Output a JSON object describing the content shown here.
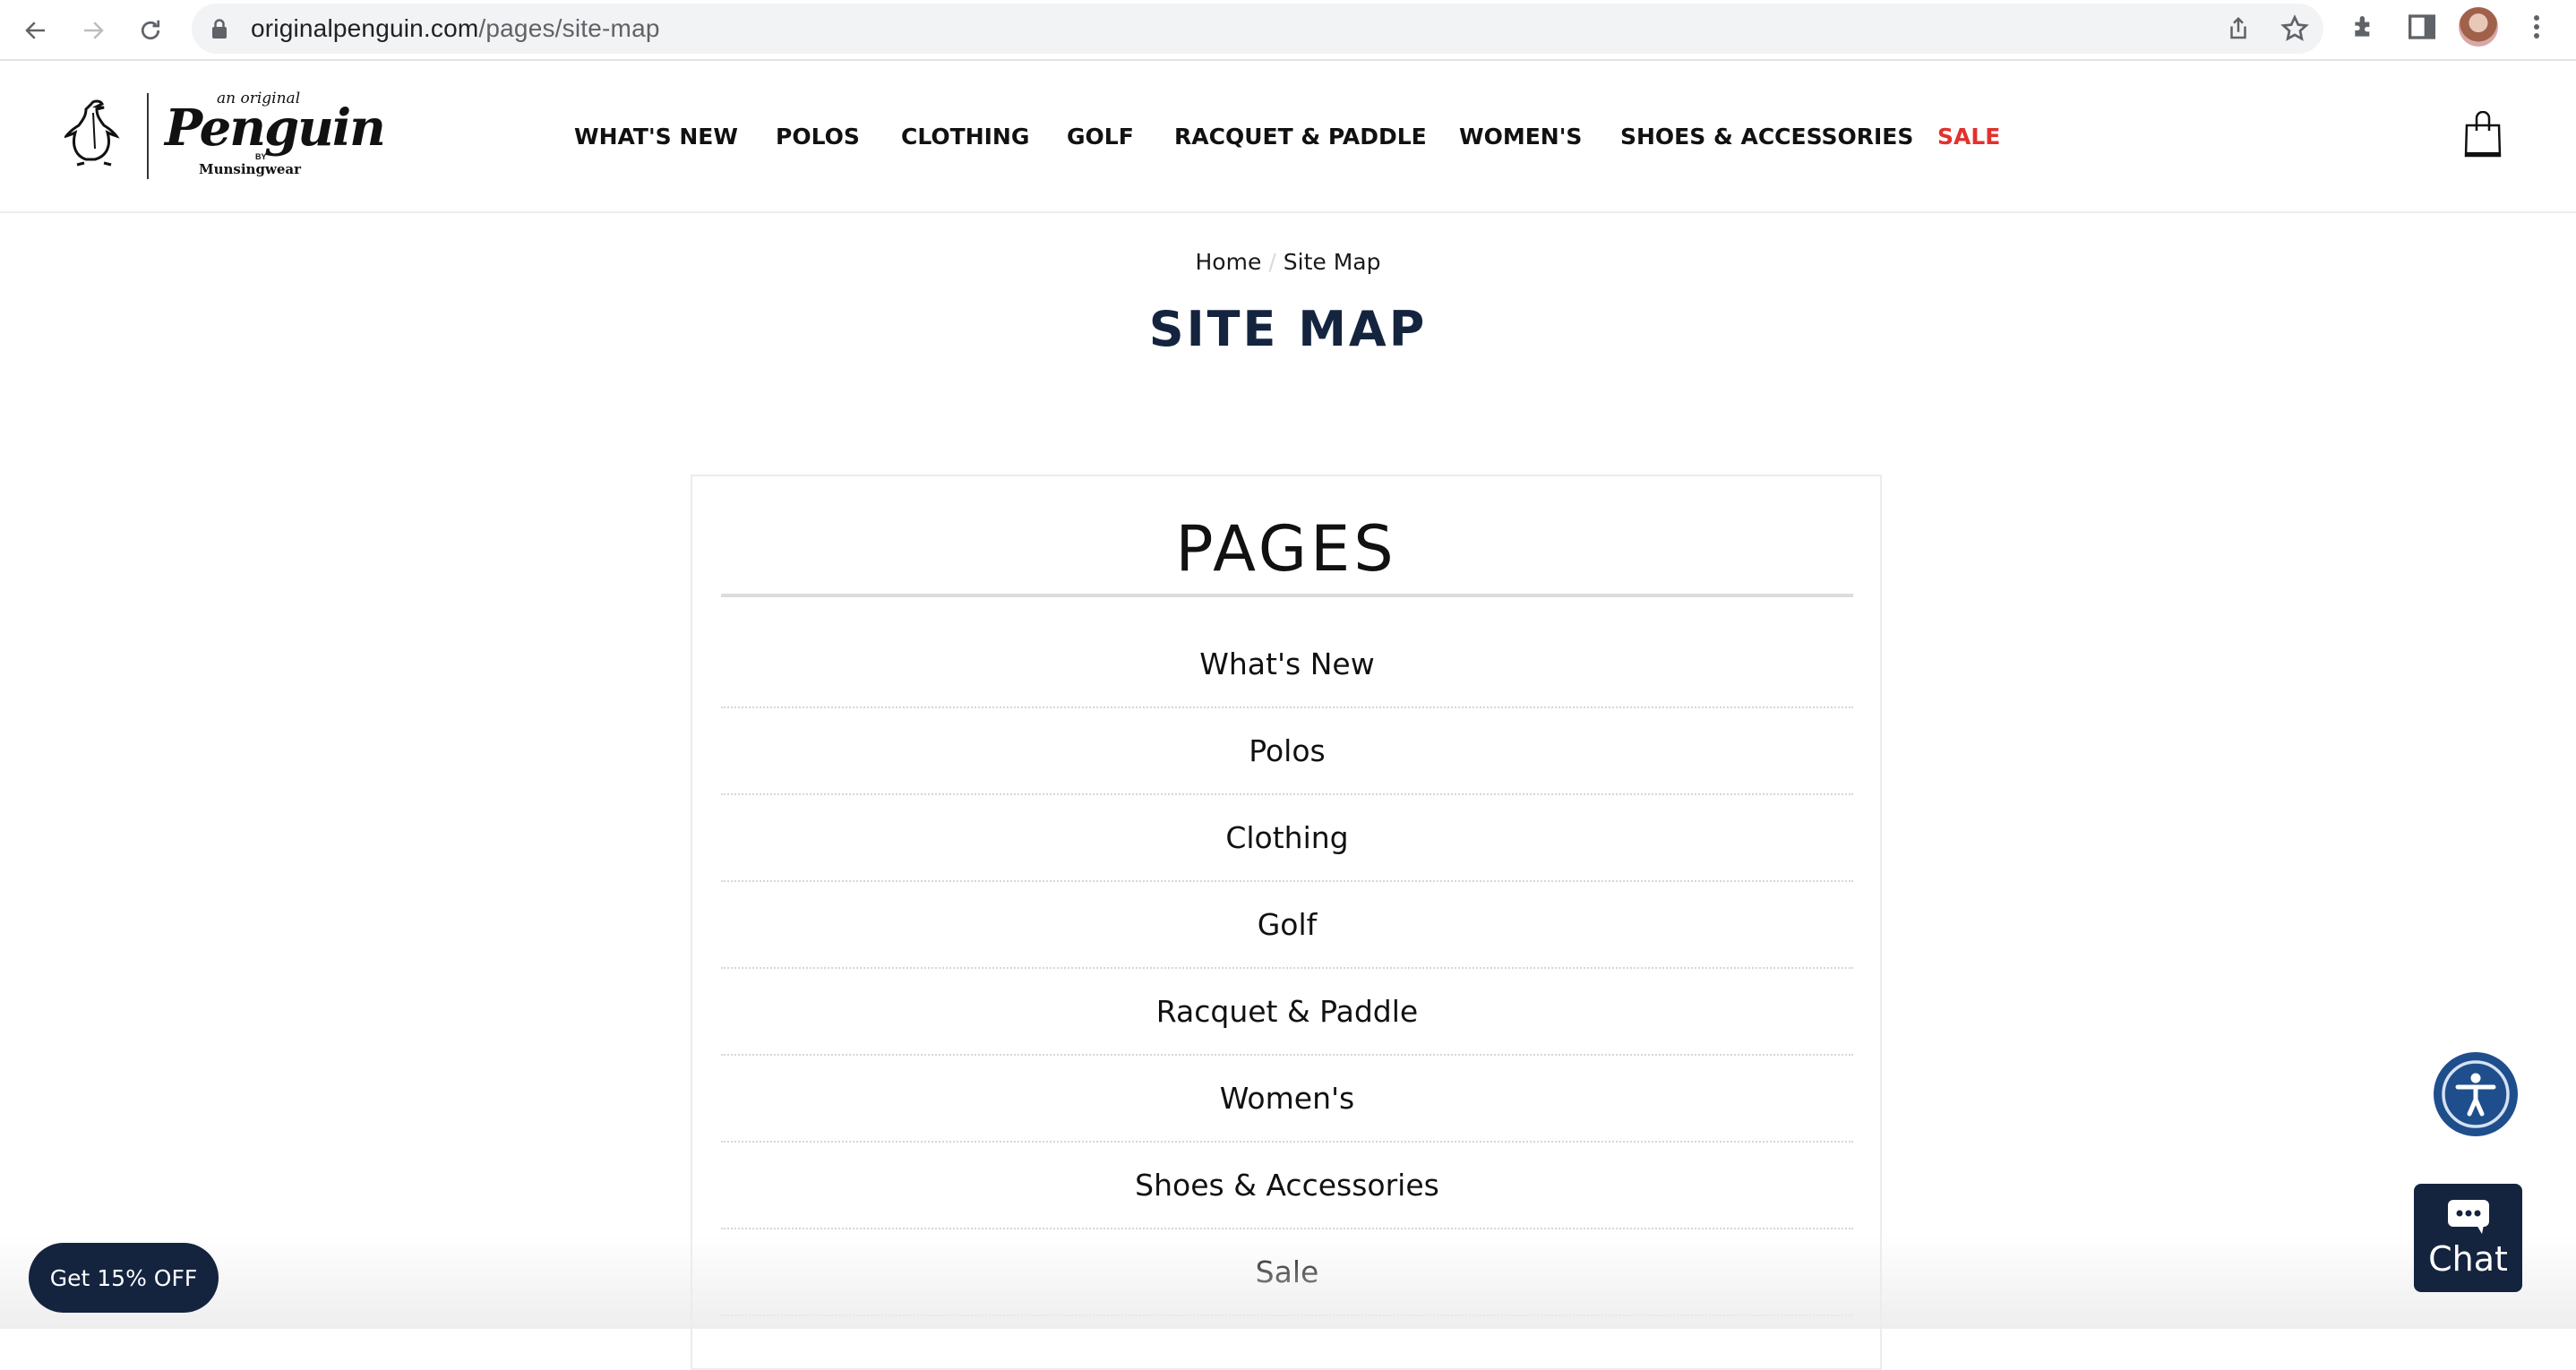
{
  "browser": {
    "url_domain": "originalpenguin.com",
    "url_path": "/pages/site-map"
  },
  "header": {
    "logo": {
      "tagline": "an original",
      "brand": "Penguin",
      "by": "BY",
      "maker": "Munsingwear"
    },
    "nav": [
      {
        "label": "WHAT'S NEW"
      },
      {
        "label": "POLOS"
      },
      {
        "label": "CLOTHING"
      },
      {
        "label": "GOLF"
      },
      {
        "label": "RACQUET & PADDLE"
      },
      {
        "label": "WOMEN'S"
      },
      {
        "label": "SHOES & ACCESSORIES"
      },
      {
        "label": "SALE"
      }
    ],
    "sale_color": "#e2312d"
  },
  "breadcrumb": {
    "home": "Home",
    "separator": "/",
    "current": "Site Map"
  },
  "page": {
    "title": "SITE MAP",
    "title_color": "#14243f"
  },
  "pages_section": {
    "heading": "PAGES",
    "items": [
      {
        "label": "What's New"
      },
      {
        "label": "Polos"
      },
      {
        "label": "Clothing"
      },
      {
        "label": "Golf"
      },
      {
        "label": "Racquet & Paddle"
      },
      {
        "label": "Women's"
      },
      {
        "label": "Shoes & Accessories"
      },
      {
        "label": "Sale"
      }
    ]
  },
  "widgets": {
    "promo_label": "Get 15% OFF",
    "chat_label": "Chat",
    "accent": "#14243f",
    "accessibility_color": "#1f4e8c"
  }
}
